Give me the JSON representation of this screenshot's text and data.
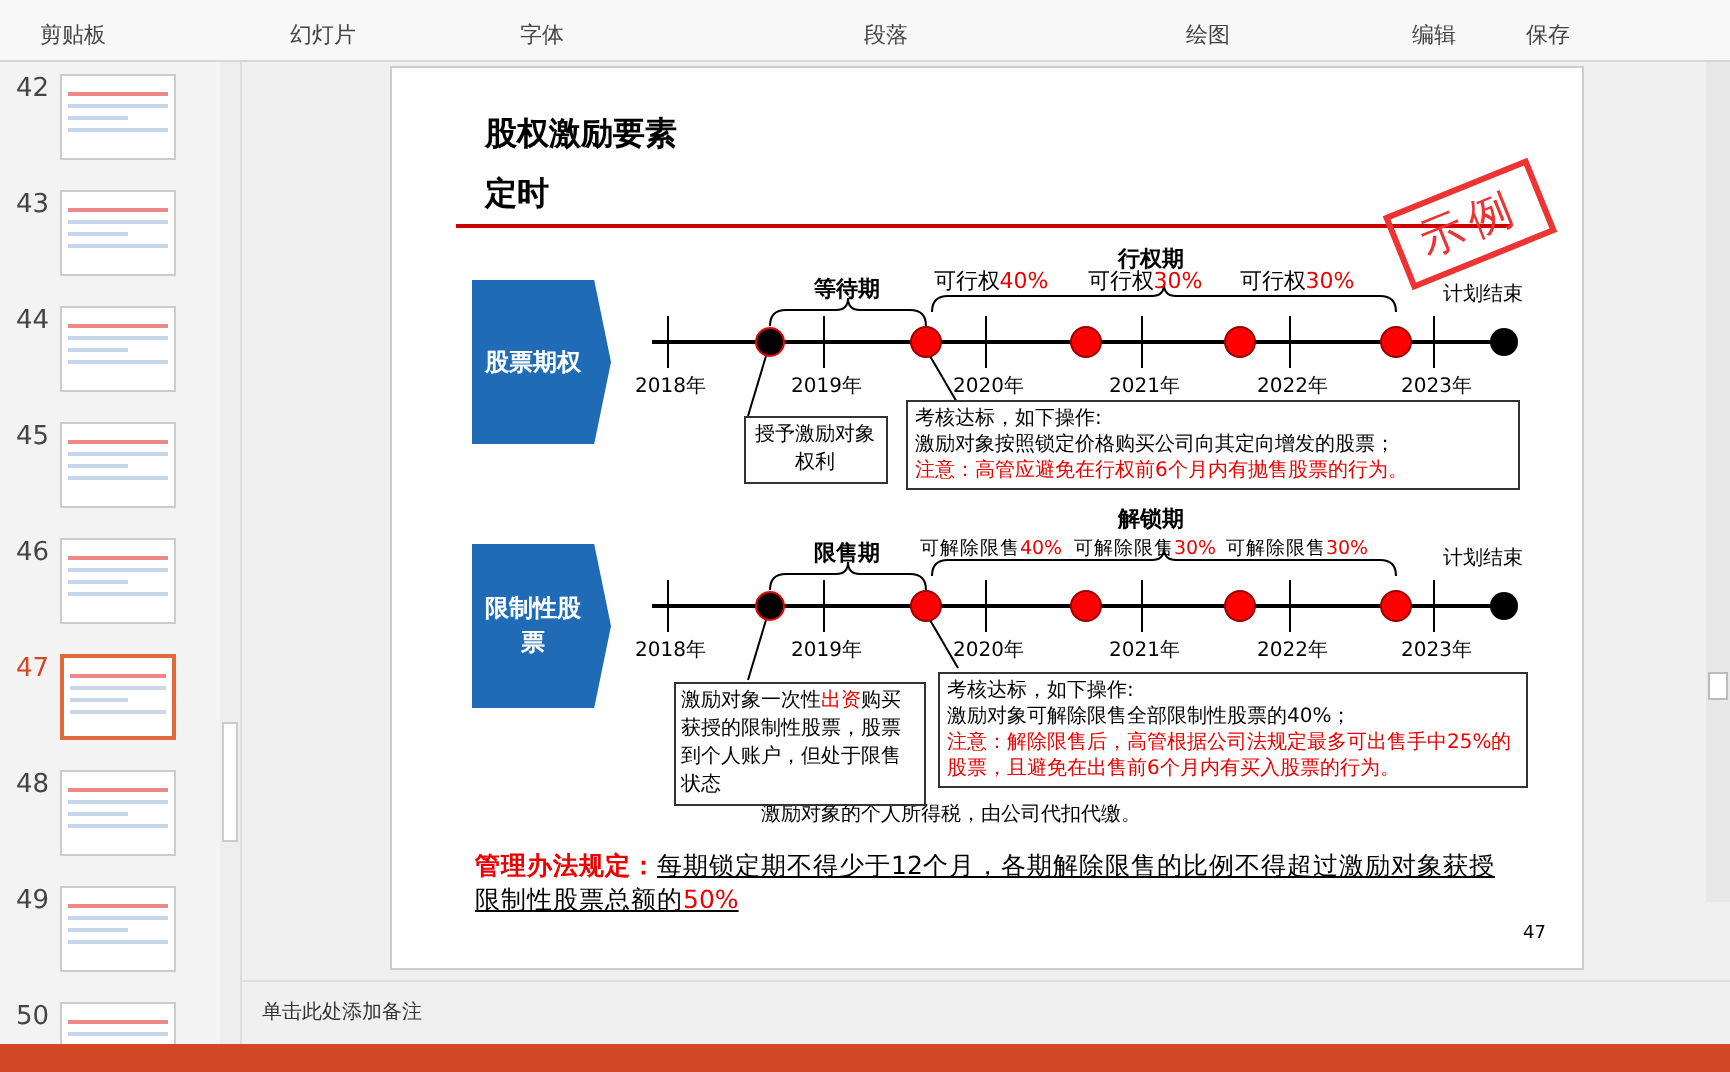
{
  "ribbon": {
    "groups": [
      "剪贴板",
      "幻灯片",
      "字体",
      "段落",
      "绘图",
      "编辑",
      "保存"
    ]
  },
  "slides": [
    {
      "number": "42",
      "selected": false
    },
    {
      "number": "43",
      "selected": false
    },
    {
      "number": "44",
      "selected": false
    },
    {
      "number": "45",
      "selected": false
    },
    {
      "number": "46",
      "selected": false
    },
    {
      "number": "47",
      "selected": true
    },
    {
      "number": "48",
      "selected": false
    },
    {
      "number": "49",
      "selected": false
    },
    {
      "number": "50",
      "selected": false
    }
  ],
  "slide": {
    "title_lines": [
      "股权激励要素",
      "定时"
    ],
    "stamp": "示例",
    "timelines": [
      {
        "label": "股票期权",
        "lock_period": "等待期",
        "release_period": "行权期",
        "tranches": [
          {
            "text": "可行权",
            "pct": "40%"
          },
          {
            "text": "可行权",
            "pct": "30%"
          },
          {
            "text": "可行权",
            "pct": "30%"
          }
        ],
        "years": [
          "2018年",
          "2019年",
          "2020年",
          "2021年",
          "2022年",
          "2023年"
        ],
        "end_label": "计划结束",
        "grant_note": [
          {
            "text": "授予激励对象权利",
            "highlight": false
          }
        ],
        "detail": {
          "heading": "考核达标，如下操作:",
          "body": "激励对象按照锁定价格购买公司向其定向增发的股票；",
          "warning": "注意：高管应避免在行权前6个月内有抛售股票的行为。"
        }
      },
      {
        "label": "限制性股票",
        "lock_period": "限售期",
        "release_period": "解锁期",
        "tranches": [
          {
            "text": "可解除限售",
            "pct": "40%"
          },
          {
            "text": "可解除限售",
            "pct": "30%"
          },
          {
            "text": "可解除限售",
            "pct": "30%"
          }
        ],
        "years": [
          "2018年",
          "2019年",
          "2020年",
          "2021年",
          "2022年",
          "2023年"
        ],
        "end_label": "计划结束",
        "grant_note": [
          {
            "text": "激励对象一次性",
            "highlight": false
          },
          {
            "text": "出资",
            "highlight": true
          },
          {
            "text": "购买获授的限制性股票，股票到个人账户，但处于限售状态",
            "highlight": false
          }
        ],
        "detail": {
          "heading": "考核达标，如下操作:",
          "body": "激励对象可解除限售全部限制性股票的40%；",
          "warning": "注意：解除限售后，高管根据公司法规定最多可出售手中25%的股票，且避免在出售前6个月内有买入股票的行为。"
        }
      }
    ],
    "tax_note": "激励对象的个人所得税，由公司代扣代缴。",
    "rule": {
      "label": "管理办法规定：",
      "text": "每期锁定期不得少于12个月，各期解除限售的比例不得超过激励对象获授限制性股票总额的",
      "highlight": "50%"
    },
    "page_number": "47"
  },
  "notes": {
    "placeholder": "单击此处添加备注"
  }
}
